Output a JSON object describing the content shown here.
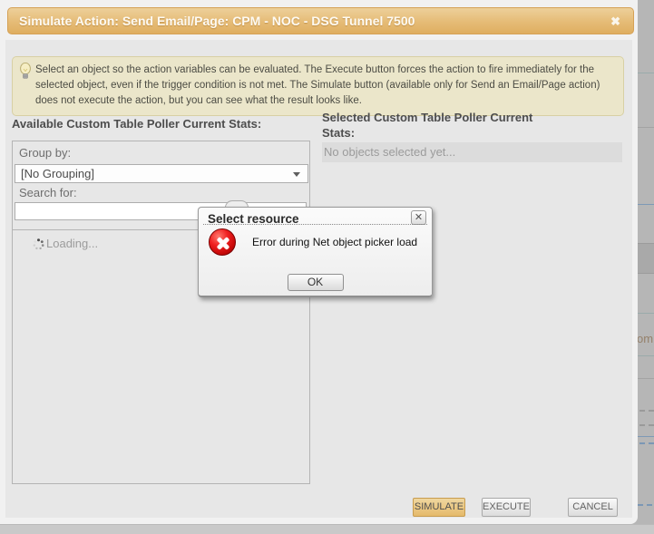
{
  "window": {
    "title": "Simulate Action: Send Email/Page: CPM - NOC - DSG Tunnel 7500"
  },
  "info_banner": {
    "text": "Select an object so the action variables can be evaluated. The Execute button forces the action to fire immediately for the selected object, even if the trigger condition is not met. The Simulate button (available only for Send an Email/Page action) does not execute the action, but you can see what the result looks like."
  },
  "available_panel": {
    "header": "Available Custom Table Poller Current Stats:",
    "group_by_label": "Group by:",
    "group_by_value": "[No Grouping]",
    "search_label": "Search for:",
    "search_value": "",
    "loading_text": "Loading..."
  },
  "selected_panel": {
    "header": "Selected Custom Table Poller Current Stats:",
    "empty_text": "No objects selected yet..."
  },
  "footer": {
    "simulate_label": "SIMULATE",
    "execute_label": "EXECUTE",
    "cancel_label": "CANCEL"
  },
  "error_dialog": {
    "title": "Select resource",
    "message": "Error during Net object picker load",
    "ok_label": "OK"
  },
  "background_page": {
    "text_fragment": "om"
  },
  "icons": {
    "window_close": "✖",
    "modal_close": "✕"
  },
  "colors": {
    "title_bar": "#e5bc76",
    "info_bg": "#ebe6ca",
    "dialog_bg": "#e7e7e7",
    "simulate_button": "#e8c27d",
    "error_red": "#d91616",
    "selected_bar": "#dcdcdc",
    "backdrop": "#b6b6b6"
  }
}
